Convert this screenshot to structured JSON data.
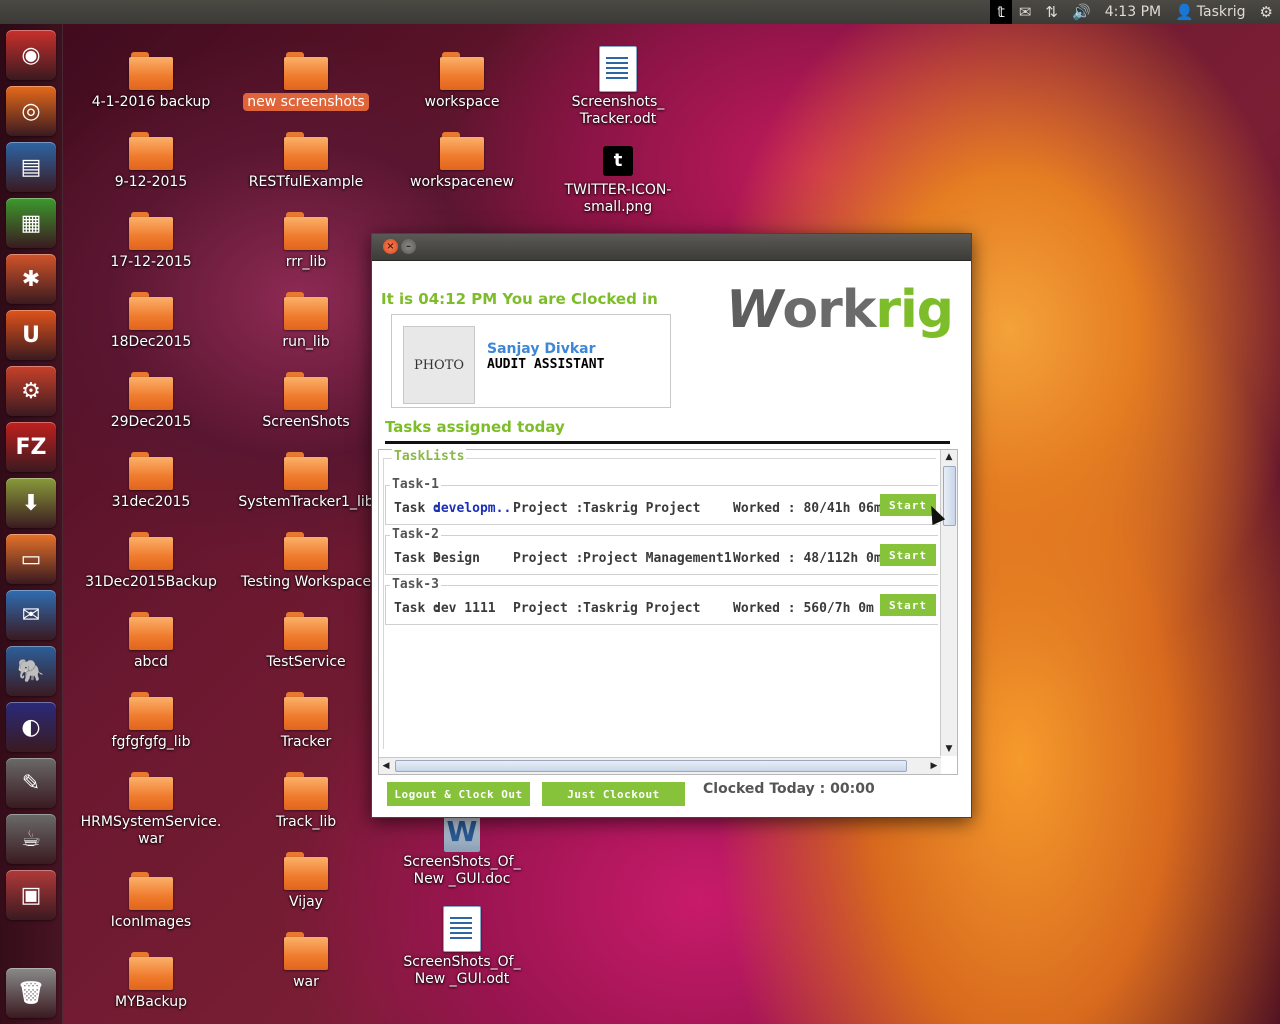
{
  "top_panel": {
    "time": "4:13 PM",
    "user": "Taskrig",
    "icons": [
      "twitter-icon",
      "mail-icon",
      "network-icon",
      "volume-icon",
      "user-icon",
      "settings-gear-icon"
    ]
  },
  "launcher": {
    "items": [
      {
        "name": "ubuntu-dash-icon",
        "glyph": "◉",
        "color": "#c9302c"
      },
      {
        "name": "firefox-icon",
        "glyph": "◎",
        "color": "#e66a1a"
      },
      {
        "name": "writer-icon",
        "glyph": "▤",
        "color": "#2d65a5"
      },
      {
        "name": "calc-icon",
        "glyph": "▦",
        "color": "#3d9a2e"
      },
      {
        "name": "software-center-icon",
        "glyph": "✱",
        "color": "#d2542a"
      },
      {
        "name": "ubuntu-one-icon",
        "glyph": "U",
        "color": "#e0531b"
      },
      {
        "name": "system-settings-icon",
        "glyph": "⚙",
        "color": "#c8412a"
      },
      {
        "name": "filezilla-icon",
        "glyph": "FZ",
        "color": "#c0201e"
      },
      {
        "name": "archive-manager-icon",
        "glyph": "⬇",
        "color": "#8a9a3a"
      },
      {
        "name": "files-icon",
        "glyph": "▭",
        "color": "#e5722a"
      },
      {
        "name": "thunderbird-icon",
        "glyph": "✉",
        "color": "#2f6db3"
      },
      {
        "name": "pgadmin-icon",
        "glyph": "🐘",
        "color": "#2c5f9a"
      },
      {
        "name": "eclipse-icon",
        "glyph": "◐",
        "color": "#2a2a7a"
      },
      {
        "name": "text-editor-icon",
        "glyph": "✎",
        "color": "#6a6a6a"
      },
      {
        "name": "java-app-icon",
        "glyph": "☕",
        "color": "#6a6a6a"
      },
      {
        "name": "workspace-switcher-icon",
        "glyph": "▣",
        "color": "#b03a3a"
      },
      {
        "name": "trash-icon",
        "glyph": "🗑",
        "color": "#8a8a8a"
      }
    ]
  },
  "desktop": {
    "icons": [
      {
        "label": "4-1-2016 backup",
        "type": "folder"
      },
      {
        "label": "new screenshots",
        "type": "folder",
        "selected": true
      },
      {
        "label": "workspace",
        "type": "folder"
      },
      {
        "label": "Screenshots_ Tracker.odt",
        "type": "odt"
      },
      {
        "label": "9-12-2015",
        "type": "folder"
      },
      {
        "label": "RESTfulExample",
        "type": "folder"
      },
      {
        "label": "workspacenew",
        "type": "folder"
      },
      {
        "label": "TWITTER-ICON- small.png",
        "type": "twitter"
      },
      {
        "label": "17-12-2015",
        "type": "folder"
      },
      {
        "label": "rrr_lib",
        "type": "folder"
      },
      {
        "label": "18Dec2015",
        "type": "folder"
      },
      {
        "label": "run_lib",
        "type": "folder"
      },
      {
        "label": "29Dec2015",
        "type": "folder"
      },
      {
        "label": "ScreenShots",
        "type": "folder"
      },
      {
        "label": "31dec2015",
        "type": "folder"
      },
      {
        "label": "SystemTracker1_lib",
        "type": "folder"
      },
      {
        "label": "31Dec2015Backup",
        "type": "folder"
      },
      {
        "label": "Testing Workspace",
        "type": "folder"
      },
      {
        "label": "abcd",
        "type": "folder"
      },
      {
        "label": "TestService",
        "type": "folder"
      },
      {
        "label": "fgfgfgfg_lib",
        "type": "folder"
      },
      {
        "label": "Tracker",
        "type": "folder"
      },
      {
        "label": "HRMSystemService. war",
        "type": "folder"
      },
      {
        "label": "Track_lib",
        "type": "folder"
      },
      {
        "label": "ScreenShots_Of_ New _GUI.doc",
        "type": "doc"
      },
      {
        "label": "IconImages",
        "type": "folder"
      },
      {
        "label": "Vijay",
        "type": "folder"
      },
      {
        "label": "ScreenShots_Of_ New _GUI.odt",
        "type": "odt"
      },
      {
        "label": "MYBackup",
        "type": "folder"
      },
      {
        "label": "war",
        "type": "folder"
      }
    ]
  },
  "app": {
    "clock_status": "It is 04:12 PM You are Clocked in",
    "logo": {
      "w": "W",
      "ork": "ork",
      "rig": "rig"
    },
    "profile": {
      "photo_label": "PHOTO",
      "name": "Sanjay Divkar",
      "title": "AUDIT ASSISTANT"
    },
    "tasks_heading": "Tasks assigned today",
    "tasklist_legend": "TaskLists",
    "tasks": [
      {
        "legend": "Task-1",
        "task_label": "Task :",
        "task_name": "developm...",
        "project_label": "Project  :",
        "project": "Taskrig Project",
        "worked": "Worked : 80/41h 06m",
        "start": "Start"
      },
      {
        "legend": "Task-2",
        "task_label": "Task :",
        "task_name": "Design",
        "project_label": "Project  :",
        "project": "Project Management1",
        "worked": "Worked : 48/112h 0m",
        "start": "Start"
      },
      {
        "legend": "Task-3",
        "task_label": "Task :",
        "task_name": "dev 1111",
        "project_label": "Project  :",
        "project": "Taskrig Project",
        "worked": "Worked : 560/7h 0m",
        "start": "Start"
      }
    ],
    "footer": {
      "logout_btn": "Logout & Clock Out",
      "clockout_btn": "Just Clockout",
      "clocked_today": "Clocked Today : 00:00"
    }
  },
  "colors": {
    "accent_green": "#86c23a",
    "link_blue": "#3d87d6",
    "panel_dark": "#3b3a36"
  }
}
